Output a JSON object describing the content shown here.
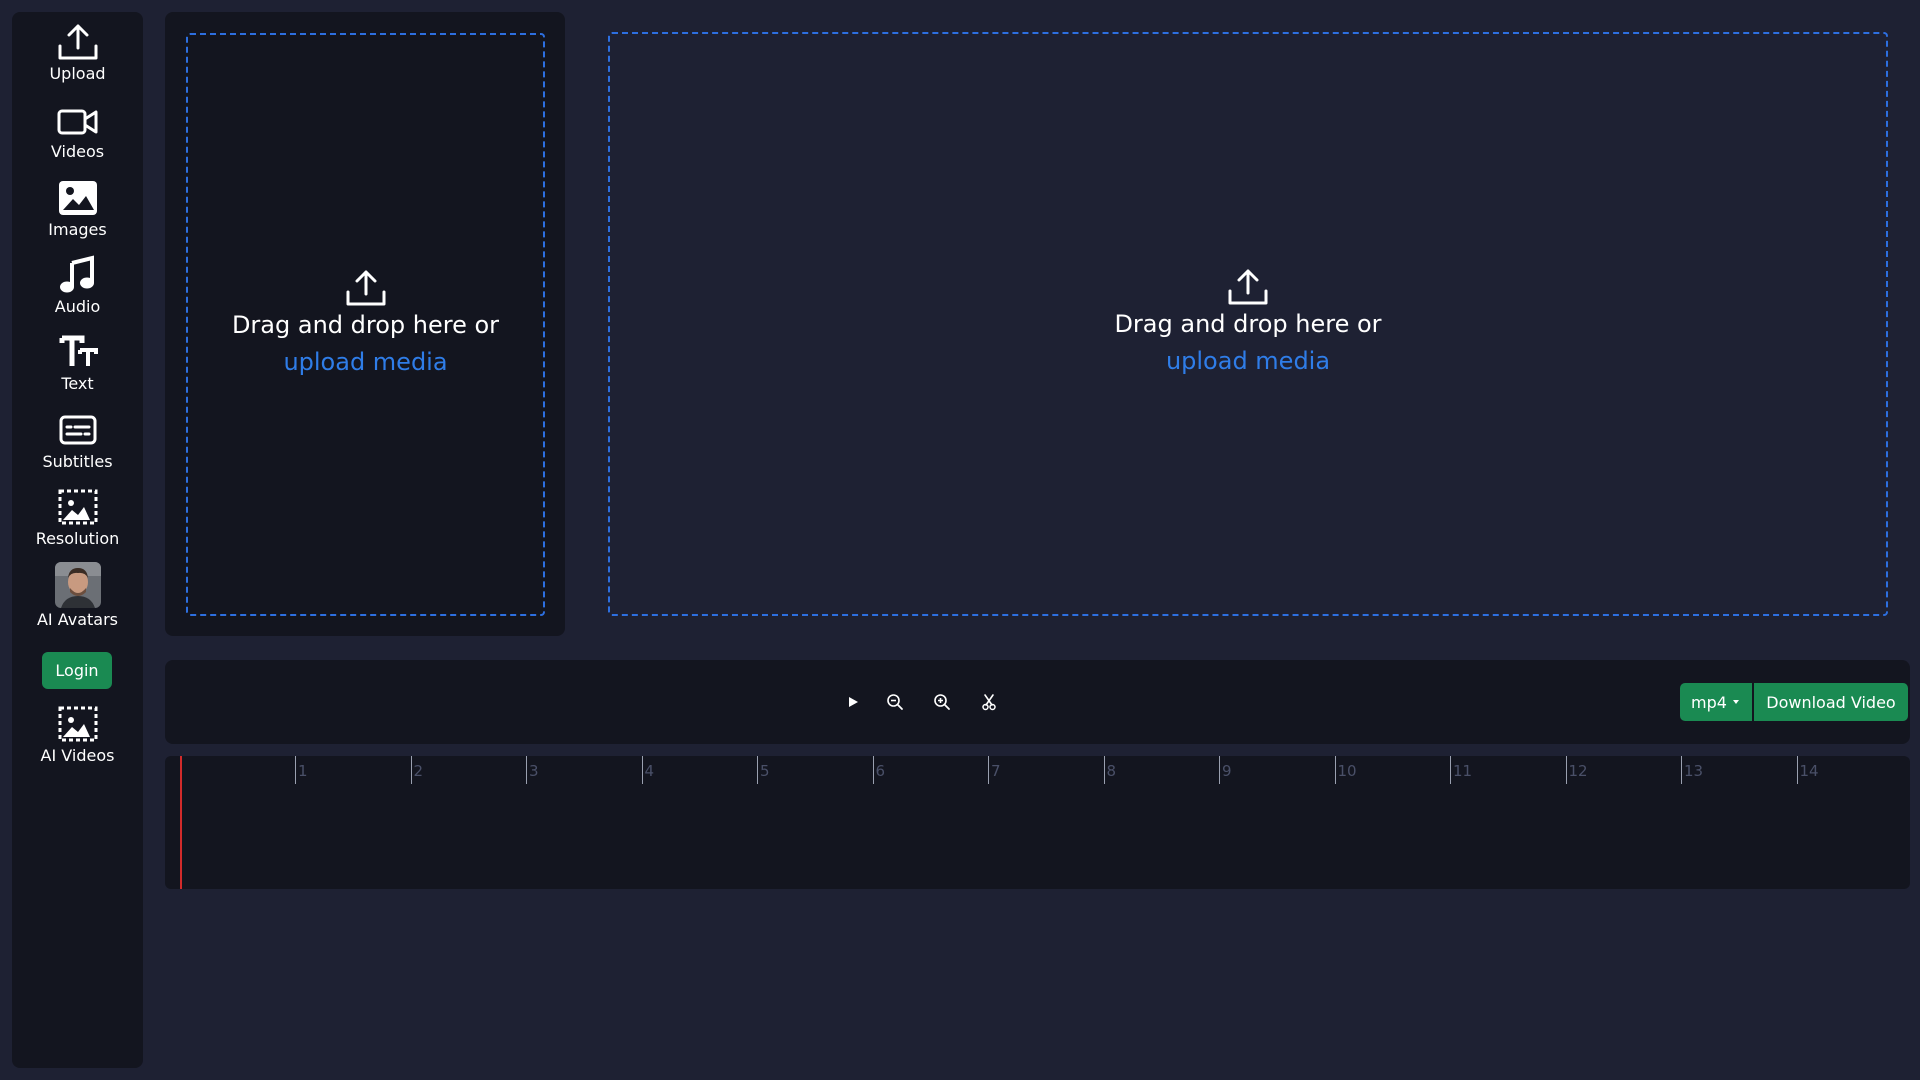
{
  "sidebar": {
    "items": [
      {
        "label": "Upload",
        "icon": "upload-icon"
      },
      {
        "label": "Videos",
        "icon": "video-camera-icon"
      },
      {
        "label": "Images",
        "icon": "image-icon"
      },
      {
        "label": "Audio",
        "icon": "music-note-icon"
      },
      {
        "label": "Text",
        "icon": "text-icon"
      },
      {
        "label": "Subtitles",
        "icon": "subtitles-icon"
      },
      {
        "label": "Resolution",
        "icon": "resolution-icon"
      },
      {
        "label": "AI Avatars",
        "icon": "avatar-photo"
      },
      {
        "label": "AI Videos",
        "icon": "ai-videos-icon"
      }
    ],
    "login_label": "Login"
  },
  "media_drop": {
    "text": "Drag and drop here or",
    "link": "upload media"
  },
  "preview_drop": {
    "text": "Drag and drop here or",
    "link": "upload media"
  },
  "toolbar": {
    "format_label": "mp4",
    "download_label": "Download Video",
    "icons": [
      "play-icon",
      "zoom-out-icon",
      "zoom-in-icon",
      "scissors-icon"
    ]
  },
  "timeline": {
    "ticks": [
      "1",
      "2",
      "3",
      "4",
      "5",
      "6",
      "7",
      "8",
      "9",
      "10",
      "11",
      "12",
      "13",
      "14"
    ]
  },
  "colors": {
    "background": "#1e2133",
    "panel": "#13151f",
    "accent_green": "#1a8a52",
    "link_blue": "#2f7de8",
    "dash_blue": "#2d6fe0",
    "playhead_red": "#d22b2b"
  }
}
